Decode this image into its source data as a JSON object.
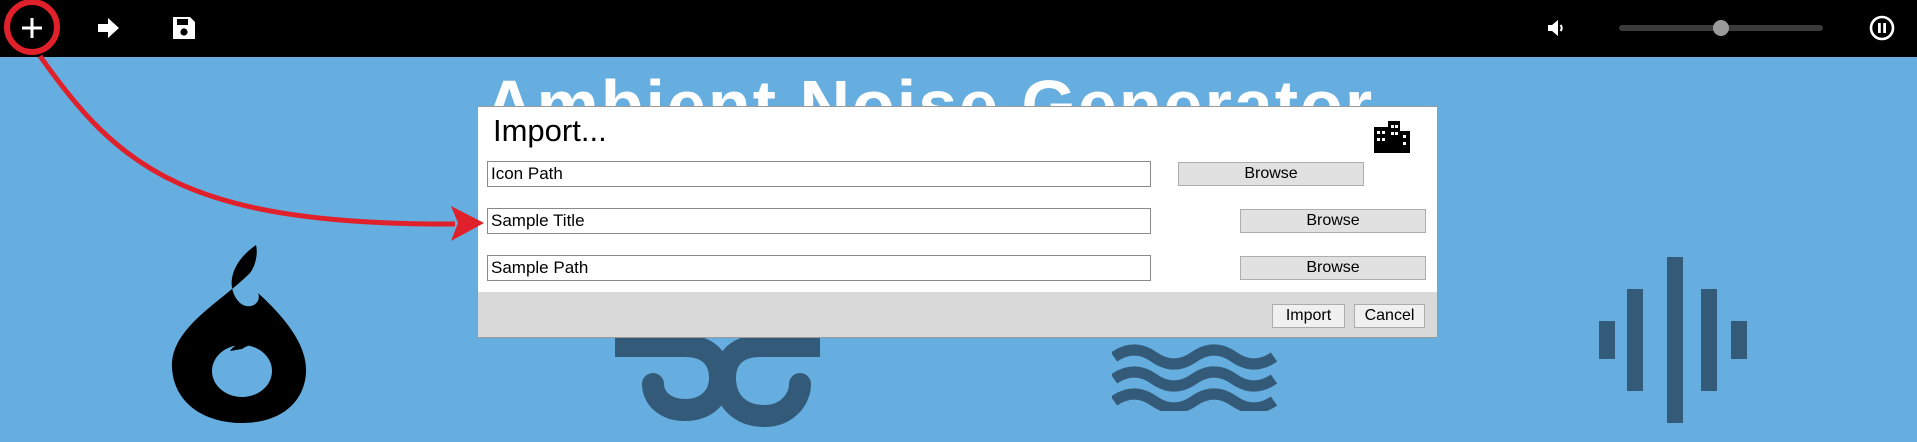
{
  "app": {
    "title": "Ambient Noise Generator"
  },
  "toolbar": {
    "add_icon": "plus-icon",
    "next_icon": "arrow-right-icon",
    "save_icon": "floppy-disk-icon",
    "volume_icon": "speaker-icon",
    "pause_icon": "pause-circle-icon",
    "volume_level": 0.5
  },
  "dialog": {
    "title": "Import...",
    "icon": "city-buildings-icon",
    "fields": [
      {
        "value": "Icon Path",
        "browse_label": "Browse"
      },
      {
        "value": "Sample Title",
        "browse_label": "Browse"
      },
      {
        "value": "Sample Path",
        "browse_label": "Browse"
      }
    ],
    "import_label": "Import",
    "cancel_label": "Cancel"
  },
  "sounds": [
    {
      "icon": "fire-icon",
      "color": "#000000"
    },
    {
      "icon": "wind-icon",
      "color": "#335a78"
    },
    {
      "icon": "water-waves-icon",
      "color": "#335a78"
    },
    {
      "icon": "sound-waveform-icon",
      "color": "#335a78"
    }
  ],
  "colors": {
    "background": "#66aedf",
    "toolbar": "#000000",
    "annotation": "#e0202a",
    "muted_icon": "#335a78"
  }
}
